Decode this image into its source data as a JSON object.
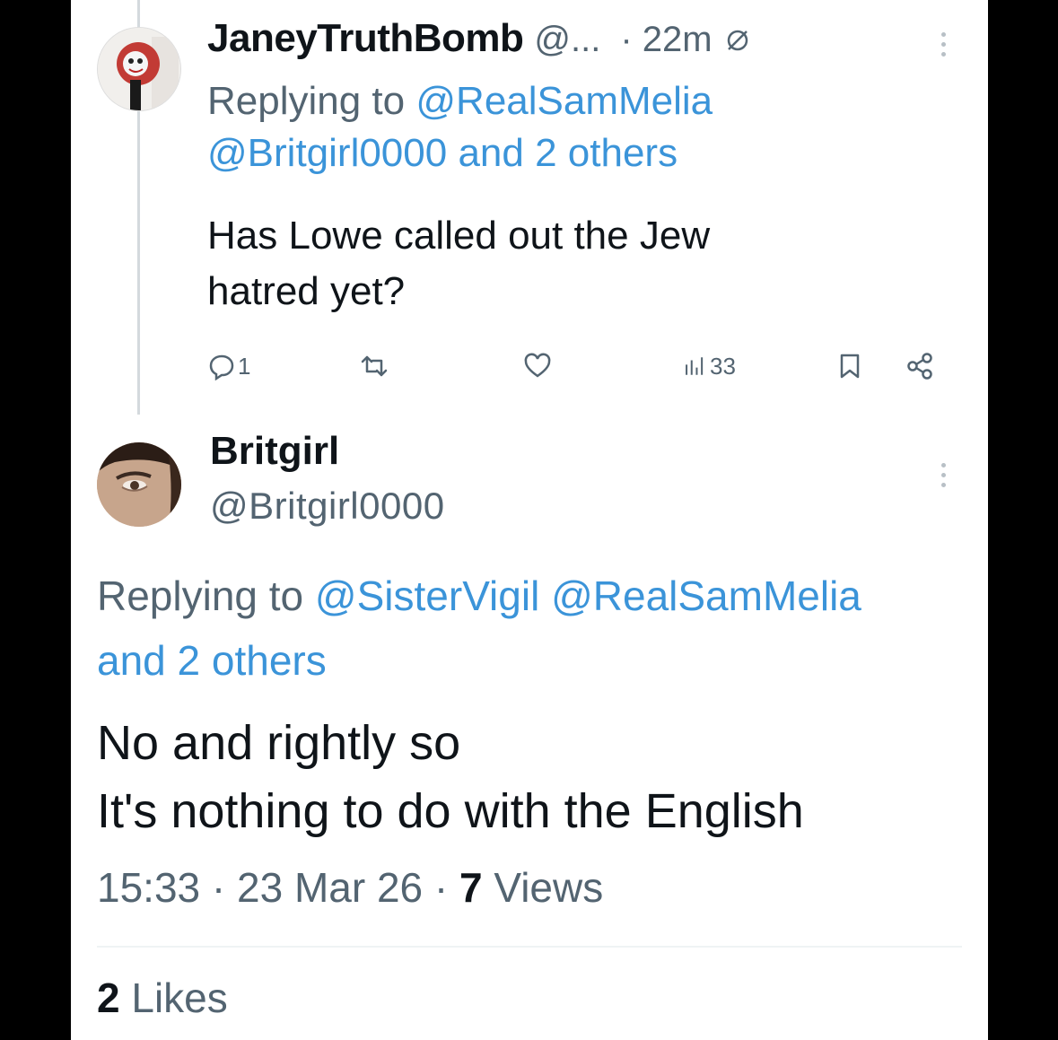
{
  "reply": {
    "display_name": "JaneyTruthBomb",
    "handle_truncated": "@...",
    "time": "· 22m",
    "replying_prefix": "Replying to",
    "replying_link_1": "@RealSamMelia",
    "replying_link_2": "@Britgirl0000 and 2 others",
    "text_line1": "Has Lowe called out the Jew",
    "text_line2": "hatred yet?",
    "reply_count": "1",
    "views_count": "33"
  },
  "tweet": {
    "display_name": "Britgirl",
    "handle": "@Britgirl0000",
    "replying_prefix": "Replying to",
    "replying_link_1": "@SisterVigil",
    "replying_link_2": "@RealSamMelia",
    "replying_link_3": "and 2 others",
    "text_line1": "No and rightly so",
    "text_line2": "It's nothing to do with the English",
    "timestamp": "15:33 · 23 Mar 26 ·",
    "views_number": "7",
    "views_label": "Views",
    "likes_number": "2",
    "likes_label": "Likes"
  },
  "icons": {
    "more": "more-dots-icon",
    "ban": "muted-ban-icon",
    "reply": "reply-icon",
    "retweet": "retweet-icon",
    "like": "heart-icon",
    "views": "analytics-icon",
    "bookmark": "bookmark-icon",
    "share": "share-icon"
  },
  "colors": {
    "link": "#3b94d9",
    "secondary_text": "#536471",
    "primary_text": "#0f1419"
  }
}
